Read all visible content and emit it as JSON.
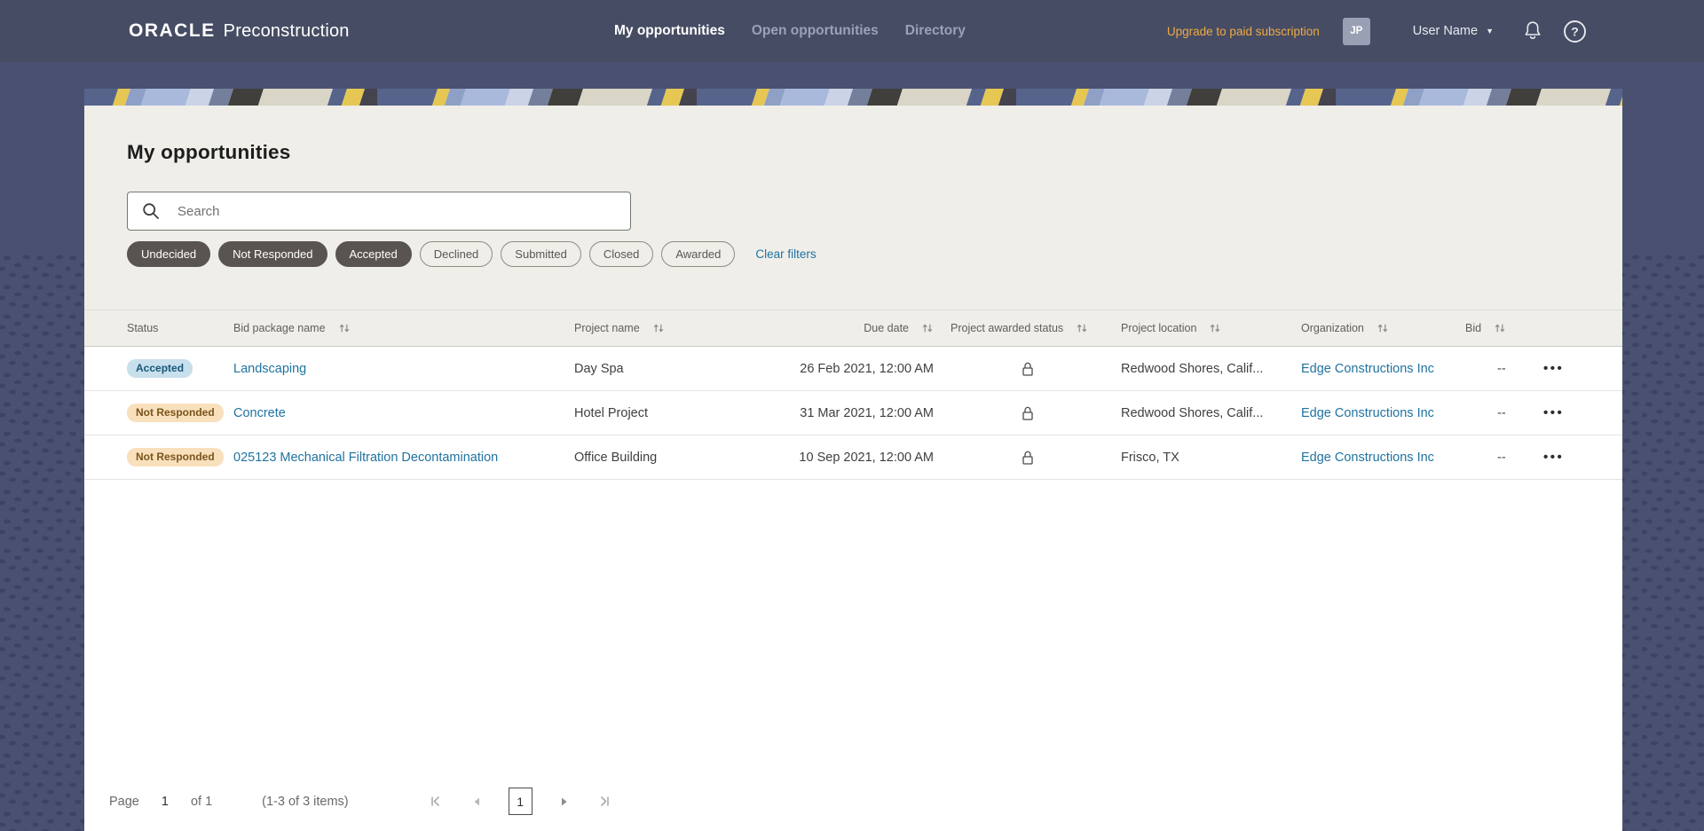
{
  "colors": {
    "header_bg": "#464C63",
    "body_bg": "#4A5170",
    "panel_bg": "#EFEEE9",
    "accent_link": "#2173A0",
    "upgrade_link": "#EFA944",
    "chip_selected_bg": "#59544F",
    "badge_accepted_bg": "#C8DFEC",
    "badge_accepted_text": "#16567B",
    "badge_not_responded_bg": "#F8E0BD",
    "badge_not_responded_text": "#7A541B"
  },
  "header": {
    "brand_oracle": "ORACLE",
    "brand_product": "Preconstruction",
    "nav": [
      {
        "label": "My opportunities",
        "active": true
      },
      {
        "label": "Open opportunities",
        "active": false
      },
      {
        "label": "Directory",
        "active": false
      }
    ],
    "upgrade_label": "Upgrade to paid subscription",
    "avatar_initials": "JP",
    "user_name": "User Name"
  },
  "icons": {
    "user_caret": "▼",
    "overflow_menu": "•••"
  },
  "page": {
    "title": "My opportunities",
    "search_placeholder": "Search",
    "filters": [
      {
        "label": "Undecided",
        "selected": true
      },
      {
        "label": "Not Responded",
        "selected": true
      },
      {
        "label": "Accepted",
        "selected": true
      },
      {
        "label": "Declined",
        "selected": false
      },
      {
        "label": "Submitted",
        "selected": false
      },
      {
        "label": "Closed",
        "selected": false
      },
      {
        "label": "Awarded",
        "selected": false
      }
    ],
    "clear_filters_label": "Clear filters"
  },
  "table": {
    "columns": {
      "status": "Status",
      "bid_package": "Bid package name",
      "project": "Project name",
      "due": "Due date",
      "awarded": "Project awarded status",
      "location": "Project location",
      "organization": "Organization",
      "bid": "Bid"
    },
    "rows": [
      {
        "status": "Accepted",
        "bid_package": "Landscaping",
        "project": "Day Spa",
        "due": "26 Feb 2021, 12:00 AM",
        "location": "Redwood Shores, Calif...",
        "organization": "Edge Constructions Inc",
        "bid": "--"
      },
      {
        "status": "Not Responded",
        "bid_package": "Concrete",
        "project": "Hotel Project",
        "due": "31 Mar 2021, 12:00 AM",
        "location": "Redwood Shores, Calif...",
        "organization": "Edge Constructions Inc",
        "bid": "--"
      },
      {
        "status": "Not Responded",
        "bid_package": "025123 Mechanical Filtration Decontamination",
        "project": "Office Building",
        "due": "10 Sep 2021, 12:00 AM",
        "location": "Frisco, TX",
        "organization": "Edge Constructions Inc",
        "bid": "--"
      }
    ]
  },
  "pagination": {
    "page_label": "Page",
    "current_page": "1",
    "of_label": "of 1",
    "items_summary": "(1-3 of 3 items)"
  }
}
